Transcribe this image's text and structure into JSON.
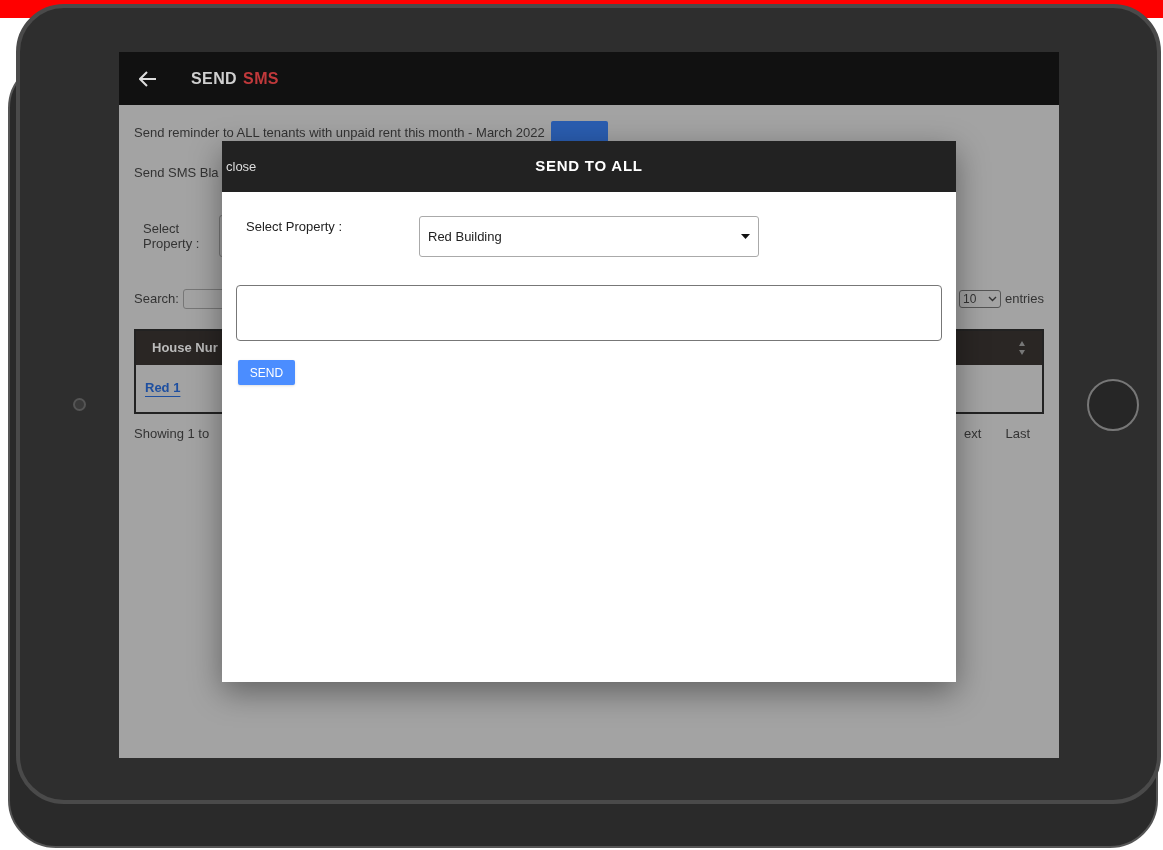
{
  "header": {
    "title": "SEND",
    "title_accent": "SMS"
  },
  "page": {
    "reminder_text": "Send reminder to ALL tenants with unpaid rent this month - March 2022",
    "blast_label": "Send SMS Bla",
    "property_label": "Select Property :",
    "search_label": "Search:",
    "entries_value": "10",
    "entries_label": "entries",
    "table": {
      "columns": [
        "House Nur"
      ],
      "rows": [
        [
          "Red 1"
        ]
      ]
    },
    "info": "Showing 1 to",
    "pagination": [
      "ext",
      "Last"
    ]
  },
  "modal": {
    "close": "close",
    "title": "SEND TO ALL",
    "property_label": "Select Property :",
    "property_value": "Red Building",
    "send_button": "SEND"
  }
}
